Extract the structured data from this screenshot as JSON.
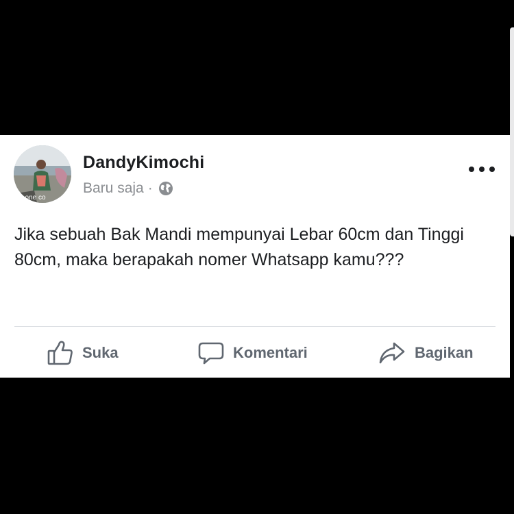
{
  "post": {
    "author": "DandyKimochi",
    "timestamp": "Baru saja",
    "separator": "·",
    "privacy_icon": "globe-icon",
    "avatar_overlay_text": "lo one co",
    "text": "Jika sebuah Bak Mandi mempunyai Lebar 60cm dan Tinggi 80cm, maka berapakah nomer Whatsapp kamu???"
  },
  "actions": {
    "like_label": "Suka",
    "comment_label": "Komentari",
    "share_label": "Bagikan"
  },
  "colors": {
    "background": "#000000",
    "card": "#ffffff",
    "text": "#1c1e21",
    "secondary_text": "#8a8d91",
    "action_text": "#606770"
  }
}
